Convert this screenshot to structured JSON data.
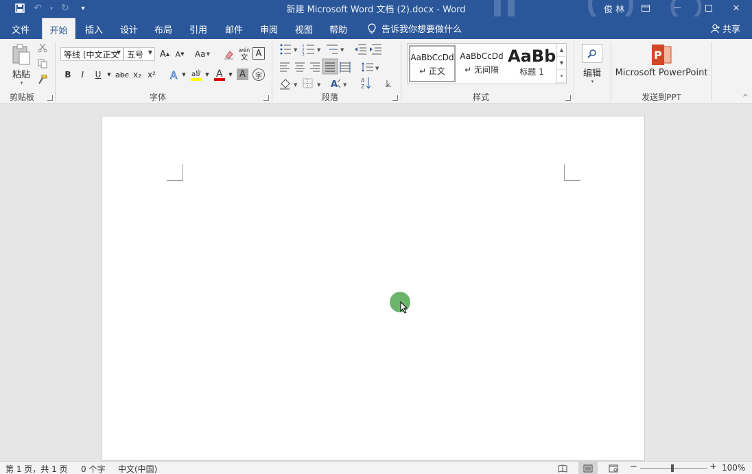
{
  "titlebar": {
    "doc_title": "新建 Microsoft Word 文档 (2).docx  -  Word",
    "user": "俊 林"
  },
  "tabs": [
    {
      "label": "文件"
    },
    {
      "label": "开始"
    },
    {
      "label": "插入"
    },
    {
      "label": "设计"
    },
    {
      "label": "布局"
    },
    {
      "label": "引用"
    },
    {
      "label": "邮件"
    },
    {
      "label": "审阅"
    },
    {
      "label": "视图"
    },
    {
      "label": "帮助"
    }
  ],
  "active_tab": "开始",
  "tellme": "告诉我你想要做什么",
  "share": "共享",
  "ribbon": {
    "clipboard": {
      "paste": "粘贴",
      "label": "剪贴板"
    },
    "font": {
      "font_name": "等线 (中文正文",
      "font_size": "五号",
      "label": "字体",
      "aa": "Aa",
      "phonetic_top": "wén",
      "phonetic_bottom": "文",
      "bold": "B",
      "italic": "I",
      "underline": "U",
      "strike": "abc",
      "sub": "x₂",
      "sup": "x²",
      "grow": "A",
      "shrink": "A",
      "border_char": "A",
      "shade_char": "A",
      "enclose": "字"
    },
    "paragraph": {
      "label": "段落"
    },
    "styles": {
      "label": "样式",
      "items": [
        {
          "preview": "AaBbCcDd",
          "name": "↵ 正文"
        },
        {
          "preview": "AaBbCcDd",
          "name": "↵ 无间隔"
        },
        {
          "preview": "AaBb",
          "name": "标题 1"
        }
      ]
    },
    "editing": {
      "label": "编辑"
    },
    "ppt": {
      "button": "Microsoft PowerPoint",
      "label": "发送到PPT"
    }
  },
  "statusbar": {
    "page": "第 1 页，共 1 页",
    "words": "0 个字",
    "language": "中文(中国)",
    "zoom": "100%"
  },
  "colors": {
    "brand": "#2b579a",
    "highlight": "#ffff00",
    "font_color": "#e00000",
    "ppt_orange": "#d24726",
    "cursor_dot": "#5fae5f"
  }
}
